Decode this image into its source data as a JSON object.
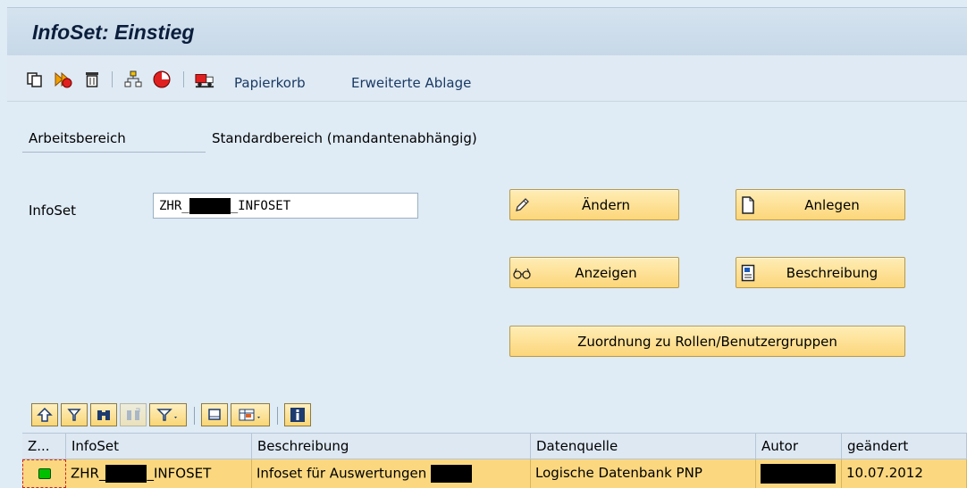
{
  "window": {
    "title": "InfoSet: Einstieg"
  },
  "toolbar": {
    "icons": [
      "copy-icon",
      "execute-icon",
      "delete-icon",
      "hierarchy-icon",
      "record-icon",
      "transport-icon"
    ],
    "papierkorb_label": "Papierkorb",
    "erweiterte_ablage_label": "Erweiterte Ablage"
  },
  "form": {
    "arbeitsbereich_label": "Arbeitsbereich",
    "arbeitsbereich_value": "Standardbereich (mandantenabhängig)",
    "infoset_label": "InfoSet",
    "infoset_value_prefix": "ZHR_",
    "infoset_value_suffix": "_INFOSET"
  },
  "buttons": {
    "aendern": "Ändern",
    "anlegen": "Anlegen",
    "anzeigen": "Anzeigen",
    "beschreibung": "Beschreibung",
    "zuordnung": "Zuordnung zu Rollen/Benutzergruppen"
  },
  "grid": {
    "columns": [
      "Z...",
      "InfoSet",
      "Beschreibung",
      "Datenquelle",
      "Autor",
      "geändert"
    ],
    "rows": [
      {
        "status_color": "#00c000",
        "infoset_prefix": "ZHR_",
        "infoset_suffix": "_INFOSET",
        "beschreibung": "Infoset für Auswertungen",
        "datenquelle": "Logische Datenbank PNP",
        "geaendert": "10.07.2012"
      }
    ]
  },
  "colors": {
    "button_fill": "#fcd67a",
    "selected_row": "#fbd880",
    "background": "#dfebf5",
    "title_text": "#0a1e3c"
  }
}
